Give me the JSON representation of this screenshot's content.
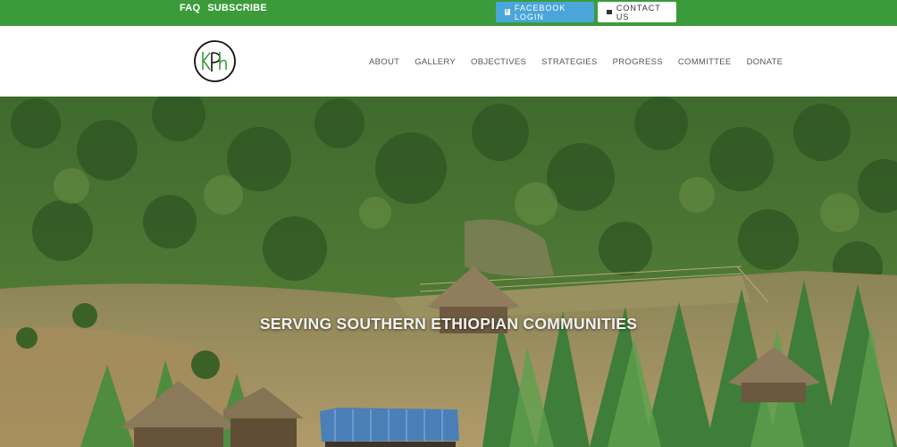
{
  "topbar": {
    "links": [
      "FAQ",
      "SUBSCRIBE"
    ],
    "facebook_label": "FACEBOOK LOGIN",
    "contact_label": "CONTACT US",
    "background": "#3b9b3a",
    "facebook_color": "#4aa6d9"
  },
  "header": {
    "logo_text": "KPh",
    "nav": [
      "ABOUT",
      "GALLERY",
      "OBJECTIVES",
      "STRATEGIES",
      "PROGRESS",
      "COMMITTEE",
      "DONATE"
    ]
  },
  "hero": {
    "title": "SERVING SOUTHERN ETHIOPIAN COMMUNITIES"
  },
  "icons": {
    "facebook": "facebook-icon",
    "mail": "mail-icon"
  }
}
